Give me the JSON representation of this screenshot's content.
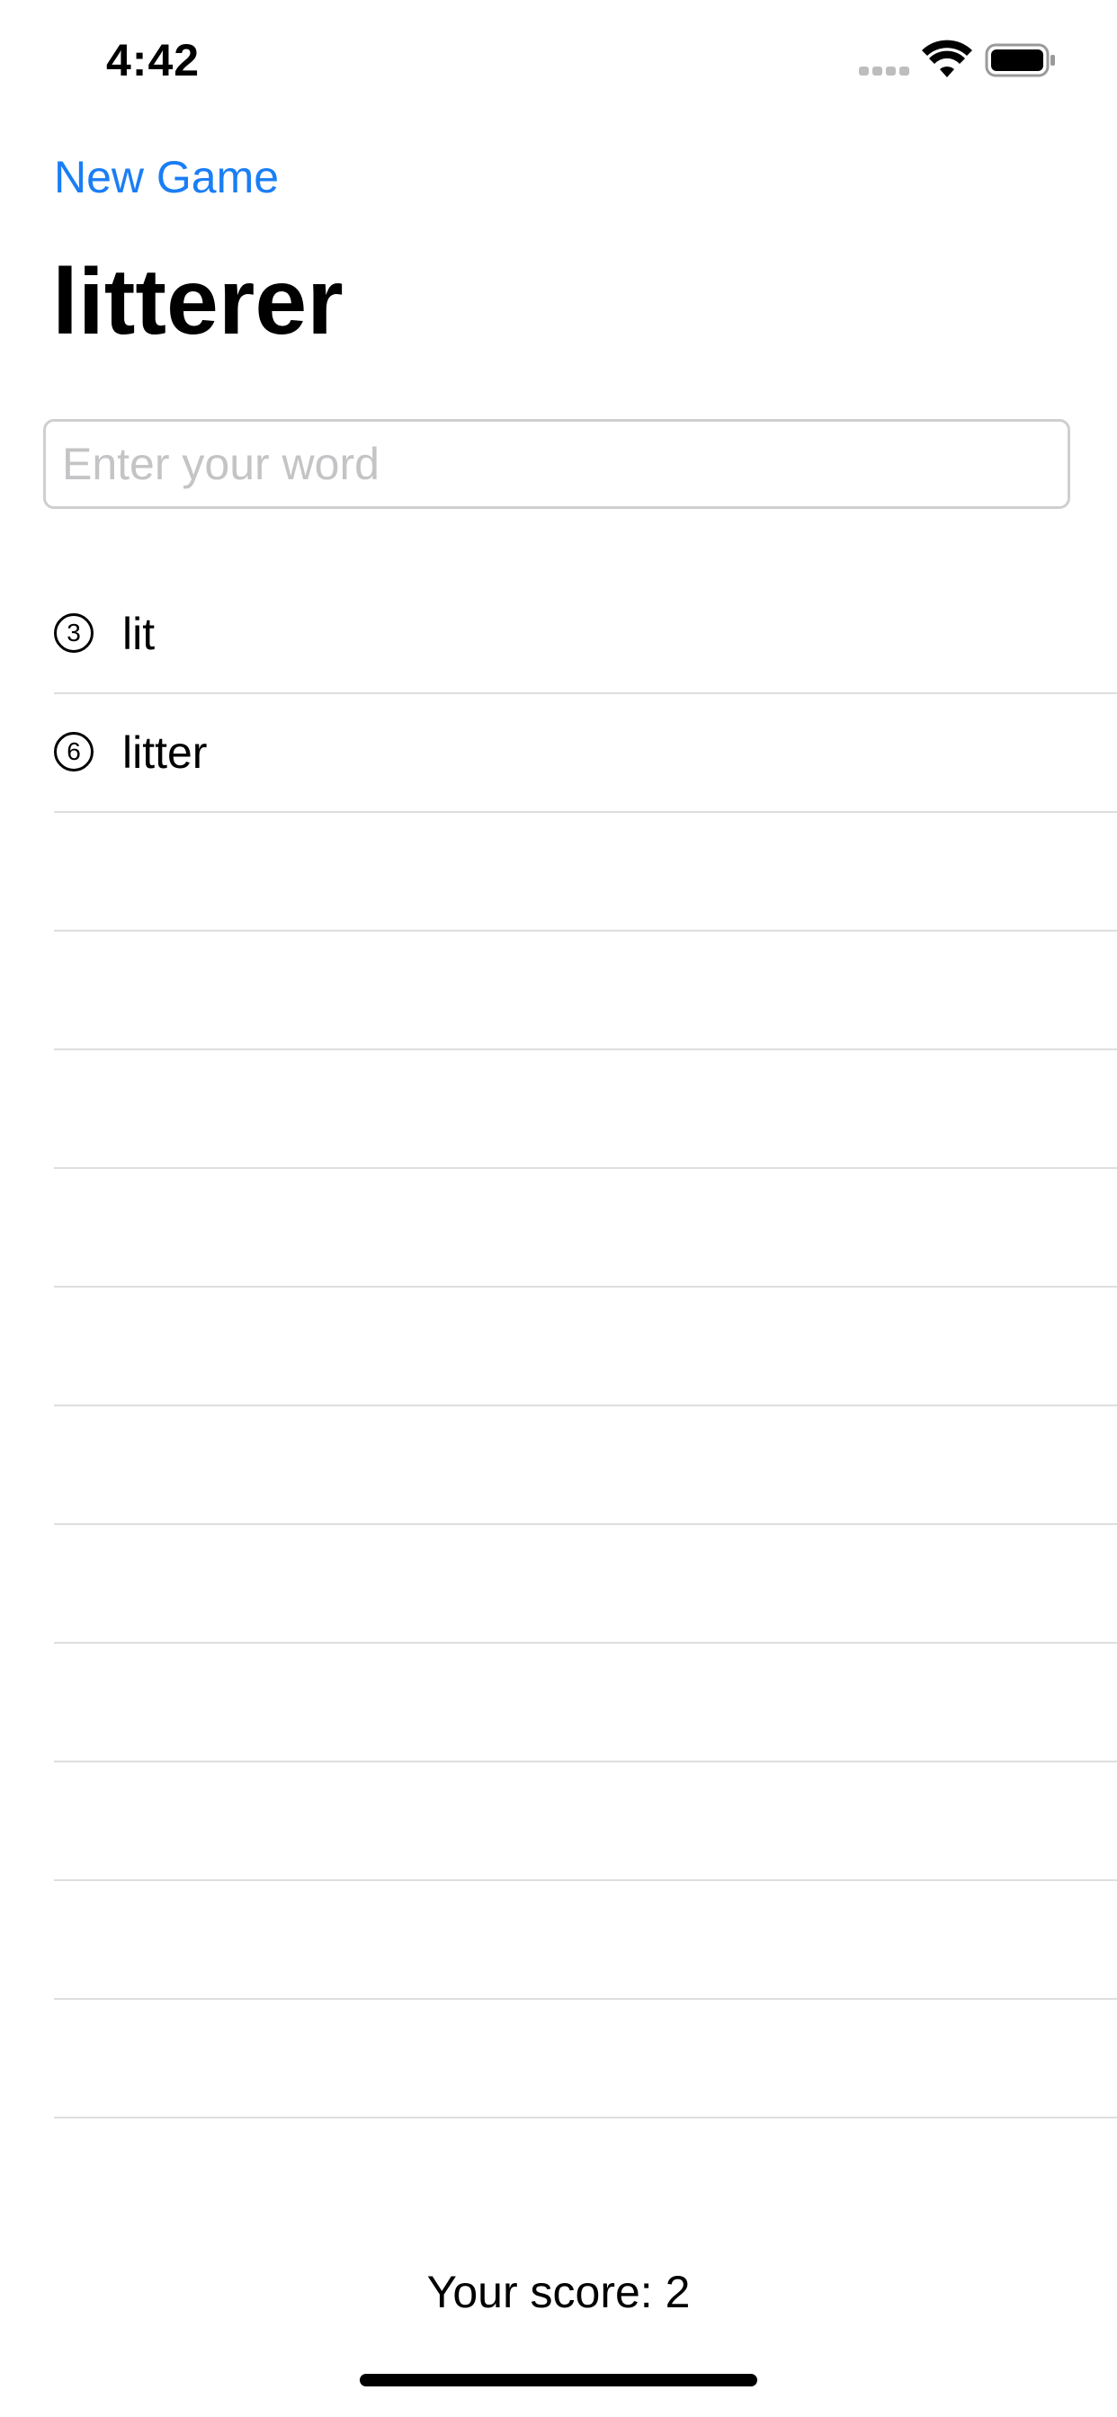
{
  "status_bar": {
    "time": "4:42",
    "icons": [
      "cellular-signal-icon",
      "wifi-icon",
      "battery-icon"
    ]
  },
  "nav": {
    "new_game_label": "New Game"
  },
  "title": "litterer",
  "input": {
    "placeholder": "Enter your word",
    "value": ""
  },
  "words": [
    {
      "length": "3",
      "word": "lit"
    },
    {
      "length": "6",
      "word": "litter"
    }
  ],
  "empty_rows": 11,
  "score_text": "Your score: 2",
  "colors": {
    "accent": "#1a7ef5",
    "separator": "#dedede",
    "placeholder": "#c4c4c6"
  }
}
